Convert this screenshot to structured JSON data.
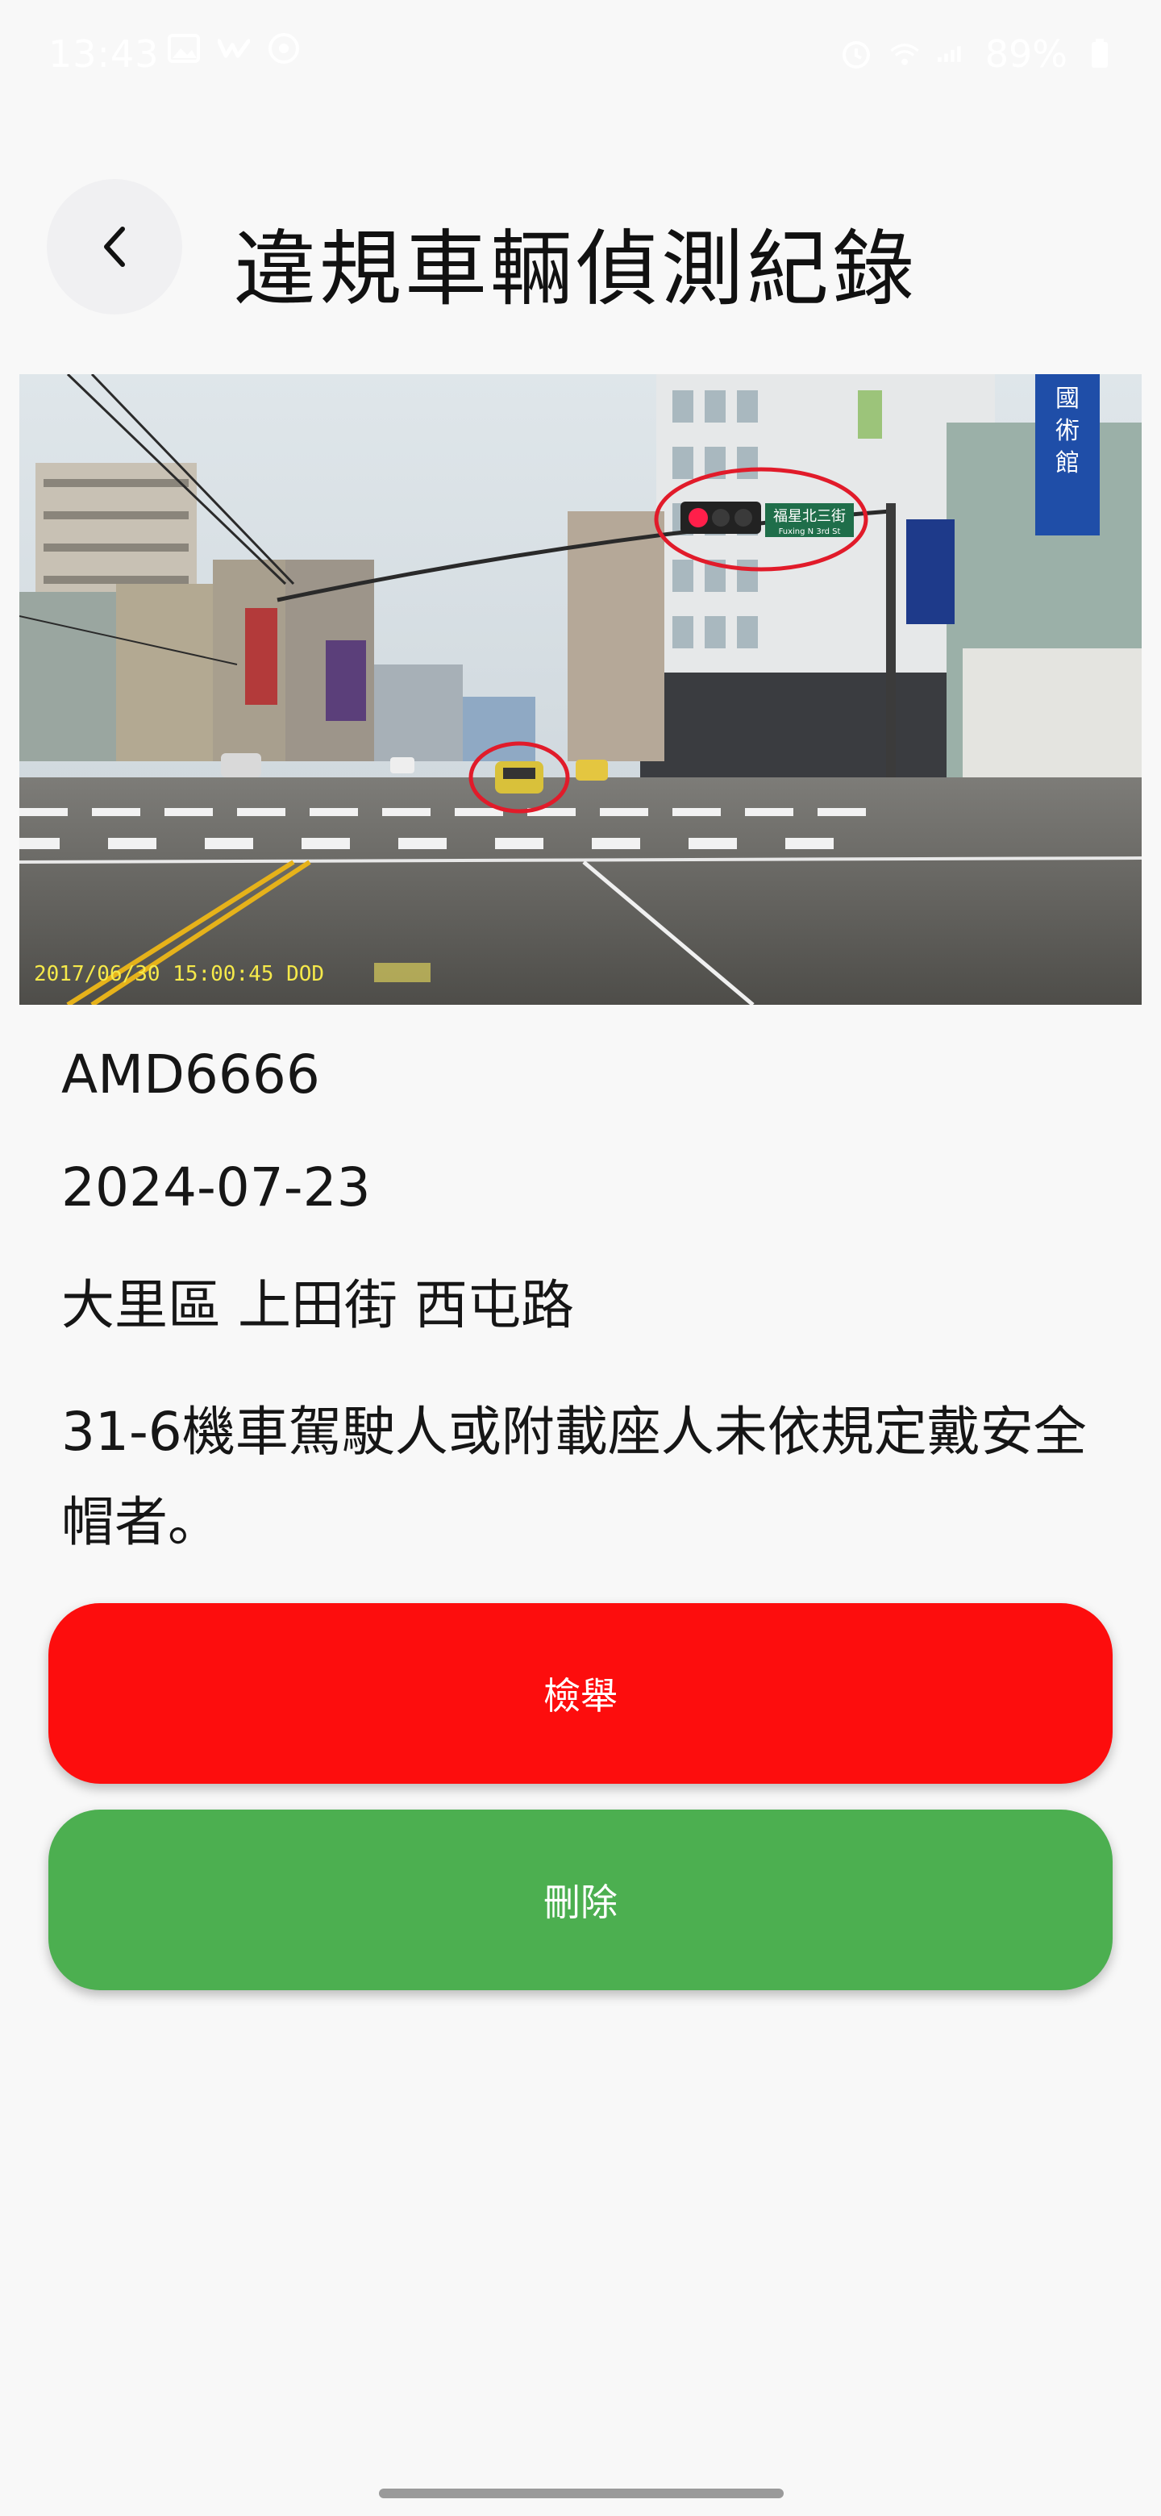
{
  "status_bar": {
    "time": "13:43",
    "battery": "89%",
    "left_icons": [
      "image-icon",
      "w-app-icon",
      "message-icon"
    ],
    "right_icons": [
      "alarm-icon",
      "wifi-icon",
      "signal-icon",
      "battery-icon"
    ]
  },
  "header": {
    "title": "違規車輛偵測紀錄",
    "back_icon": "chevron-left-icon"
  },
  "photo": {
    "timestamp_overlay": "2017/06/30 15:00:45 DOD",
    "sign_text": "福星北三街",
    "sign_subtext": "Fuxing N 3rd St",
    "store_sign": "國術館"
  },
  "record": {
    "plate": "AMD6666",
    "date": "2024-07-23",
    "location": "大里區 上田街 西屯路",
    "violation": "31-6機車駕駛人或附載座人未依規定戴安全帽者。"
  },
  "actions": {
    "report_label": "檢舉",
    "delete_label": "刪除"
  },
  "colors": {
    "report": "#fd0d0d",
    "delete": "#4caf50",
    "background": "#f8f8f8"
  }
}
